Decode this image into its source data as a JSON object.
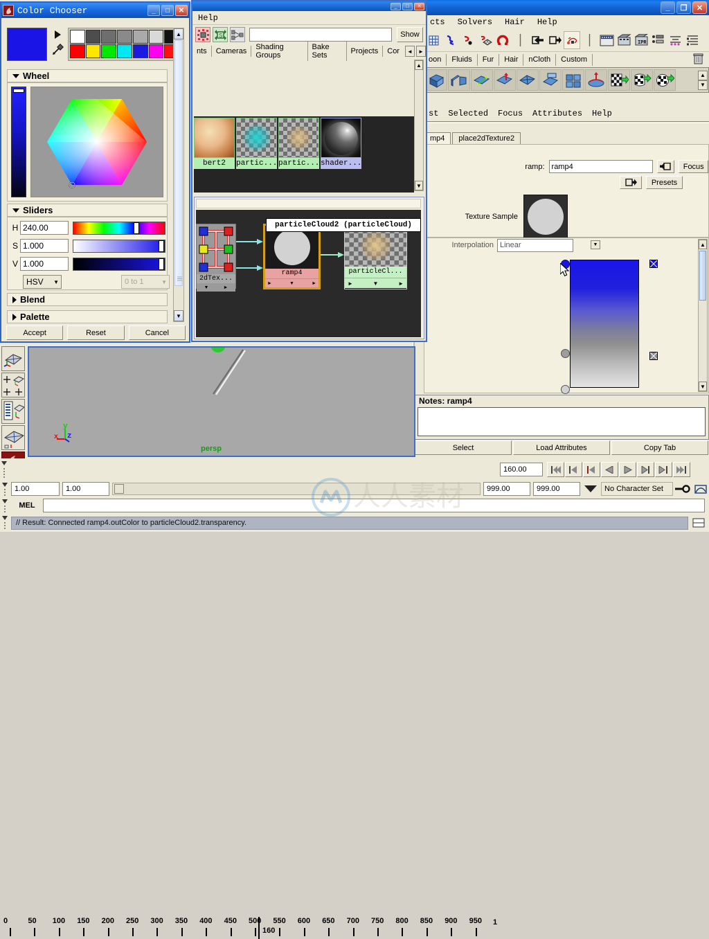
{
  "color_chooser": {
    "title": "Color Chooser",
    "current_color": "#1a15e6",
    "swatches_row1": [
      "#ffffff",
      "#4d4d4d",
      "#6e6e6e",
      "#8a8a8a",
      "#aaaaaa",
      "#d9d9d9",
      "#111111"
    ],
    "swatches_row2": [
      "#ff0000",
      "#ffe600",
      "#00e800",
      "#00e8f0",
      "#1a1ae0",
      "#ff00ee",
      "#ff1111"
    ],
    "sections": {
      "wheel": "Wheel",
      "sliders": "Sliders",
      "blend": "Blend",
      "palette": "Palette"
    },
    "sliders": [
      {
        "label": "H",
        "value": "240.00",
        "pos_pct": 66
      },
      {
        "label": "S",
        "value": "1.000",
        "pos_pct": 96
      },
      {
        "label": "V",
        "value": "1.000",
        "pos_pct": 96
      }
    ],
    "mode_select": "HSV",
    "range_select": "0 to 1",
    "buttons": [
      "Accept",
      "Reset",
      "Cancel"
    ],
    "win_controls": [
      "_",
      "□",
      "✕"
    ]
  },
  "hypershade": {
    "menus": [
      "Help"
    ],
    "toolbar_icons": [
      "clear-graph-icon",
      "rearrange-graph-icon",
      "input-output-connections-icon"
    ],
    "filter_placeholder": "",
    "show_button": "Show",
    "tabs": [
      "nts",
      "Cameras",
      "Shading Groups",
      "Bake Sets",
      "Projects",
      "Cor"
    ],
    "tab_arrows": [
      "◄",
      "►"
    ],
    "swatches": [
      {
        "label": "bert2",
        "type": "lambert-swatch"
      },
      {
        "label": "partic...",
        "type": "particle-cloud-swatch"
      },
      {
        "label": "partic...",
        "type": "particle-cloud-swatch"
      },
      {
        "label": "shader...",
        "type": "shader-sphere-swatch"
      }
    ],
    "graph": {
      "tooltip": "particleCloud2 (particleCloud)",
      "nodes": [
        {
          "label": "2dTex...",
          "kind": "place2dTexture"
        },
        {
          "label": "ramp4",
          "kind": "ramp"
        },
        {
          "label": "particleCl...",
          "kind": "particleCloud"
        }
      ]
    }
  },
  "maya": {
    "menubar": [
      "cts",
      "Solvers",
      "Hair",
      "Help"
    ],
    "shelf_tabs": [
      "oon",
      "Fluids",
      "Fur",
      "Hair",
      "nCloth",
      "Custom"
    ],
    "toolbar_icons": [
      "grid-icon",
      "snap-curve-icon",
      "snap-point-icon",
      "snap-view-plane-icon",
      "magnet-icon",
      "separator",
      "make-live-icon",
      "input-icon",
      "output-icon",
      "construction-history-icon",
      "separator",
      "render-view-icon",
      "render-current-frame-icon",
      "ipr-render-icon",
      "render-settings-icon",
      "hypershade-icon",
      "render-layer-editor-icon",
      "display-layer-icon"
    ],
    "shelf_icons": [
      "polygon-cube-icon",
      "polygon-split-icon",
      "polygon-append-icon",
      "polygon-extrude-icon",
      "polygon-triangulate-icon",
      "polygon-collapse-icon",
      "polygon-quadrangulate-icon",
      "polygon-smooth-icon",
      "uv-planar-icon",
      "uv-cylindrical-icon",
      "uv-spherical-icon"
    ],
    "trash_icon": "trash-icon",
    "attribute_editor": {
      "menus": [
        "st",
        "Selected",
        "Focus",
        "Attributes",
        "Help"
      ],
      "tabs": [
        "mp4",
        "place2dTexture2"
      ],
      "node_label": "ramp:",
      "node_name": "ramp4",
      "buttons": [
        "Focus",
        "Presets"
      ],
      "texture_sample_label": "Texture Sample",
      "interpolation_label": "Interpolation",
      "interpolation_value": "Linear",
      "ramp_markers": [
        {
          "position_pct": 2,
          "color": "#1a15e6",
          "selected": true
        },
        {
          "position_pct": 72,
          "color": "#9d9d9d",
          "selected": false
        },
        {
          "position_pct": 99,
          "color": "#cccccc",
          "selected": false
        }
      ],
      "notes_label": "Notes: ramp4",
      "notes_value": "",
      "footer_buttons": [
        "Select",
        "Load Attributes",
        "Copy Tab"
      ]
    }
  },
  "viewport": {
    "camera_label": "persp",
    "axis_labels": [
      "x",
      "y",
      "z"
    ],
    "background": "#a8a8a8"
  },
  "toolbox_icons": [
    "shaded-display-icon",
    "four-view-layout-icon",
    "outliner-persp-layout-icon",
    "single-persp-layout-icon",
    "maya-logo-icon"
  ],
  "timeline": {
    "ticks": [
      0,
      50,
      100,
      150,
      200,
      250,
      300,
      350,
      400,
      450,
      500,
      550,
      600,
      650,
      700,
      750,
      800,
      850,
      900,
      950
    ],
    "current_frame_label": "160",
    "end_label": "1",
    "current_time_field": "160.00",
    "range_start": "1.00",
    "range_end": "1.00",
    "range_max_a": "999.00",
    "range_max_b": "999.00",
    "character_set": "No Character Set",
    "playback_buttons": [
      "go-to-start-icon",
      "step-back-keyframe-icon",
      "step-back-frame-icon",
      "play-backwards-icon",
      "play-forwards-icon",
      "step-forward-frame-icon",
      "step-forward-keyframe-icon",
      "go-to-end-icon"
    ],
    "auto_key_icon": "auto-keyframe-icon",
    "anim_prefs_icon": "animation-preferences-icon"
  },
  "command_line": {
    "label": "MEL",
    "value": "",
    "result": "// Result: Connected ramp4.outColor to particleCloud2.transparency."
  }
}
